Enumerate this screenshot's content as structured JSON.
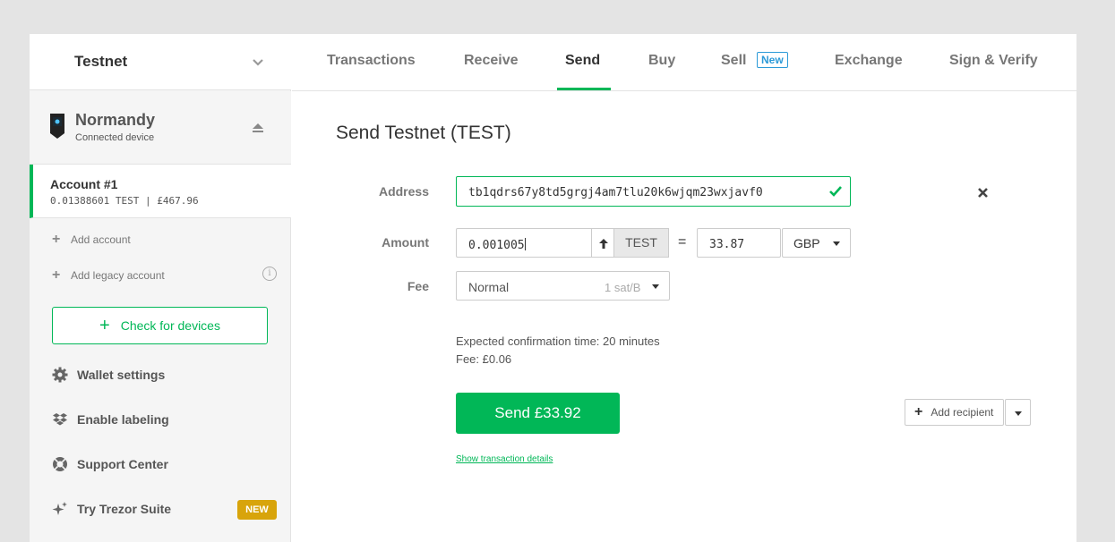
{
  "sidebar": {
    "coin_name": "Testnet",
    "device": {
      "name": "Normandy",
      "status": "Connected device"
    },
    "account": {
      "name": "Account #1",
      "balance": "0.01388601 TEST | £467.96"
    },
    "add_account": "Add account",
    "add_legacy_account": "Add legacy account",
    "check_devices": "Check for devices",
    "items": [
      {
        "label": "Wallet settings",
        "icon": "gear-icon"
      },
      {
        "label": "Enable labeling",
        "icon": "dropbox-icon"
      },
      {
        "label": "Support Center",
        "icon": "lifebuoy-icon"
      },
      {
        "label": "Try Trezor Suite",
        "icon": "sparkle-icon",
        "badge": "NEW"
      }
    ]
  },
  "tabs": [
    {
      "label": "Transactions"
    },
    {
      "label": "Receive"
    },
    {
      "label": "Send",
      "active": true
    },
    {
      "label": "Buy"
    },
    {
      "label": "Sell",
      "badge": "New"
    },
    {
      "label": "Exchange"
    },
    {
      "label": "Sign & Verify"
    }
  ],
  "send": {
    "title": "Send Testnet (TEST)",
    "address_label": "Address",
    "address_value": "tb1qdrs67y8td5grgj4am7tlu20k6wjqm23wxjavf0",
    "amount_label": "Amount",
    "amount_value": "0.001005",
    "unit": "TEST",
    "equals": "=",
    "fiat_value": "33.87",
    "currency": "GBP",
    "fee_label": "Fee",
    "fee_level": "Normal",
    "fee_rate": "1 sat/B",
    "confirmation_time": "Expected confirmation time: 20 minutes",
    "fee_text": "Fee: £0.06",
    "send_button": "Send £33.92",
    "show_details": "Show transaction details",
    "add_recipient": "Add recipient"
  },
  "colors": {
    "accent": "#01b757",
    "new_badge": "#d8a40b",
    "sell_badge": "#2c9ad8"
  }
}
